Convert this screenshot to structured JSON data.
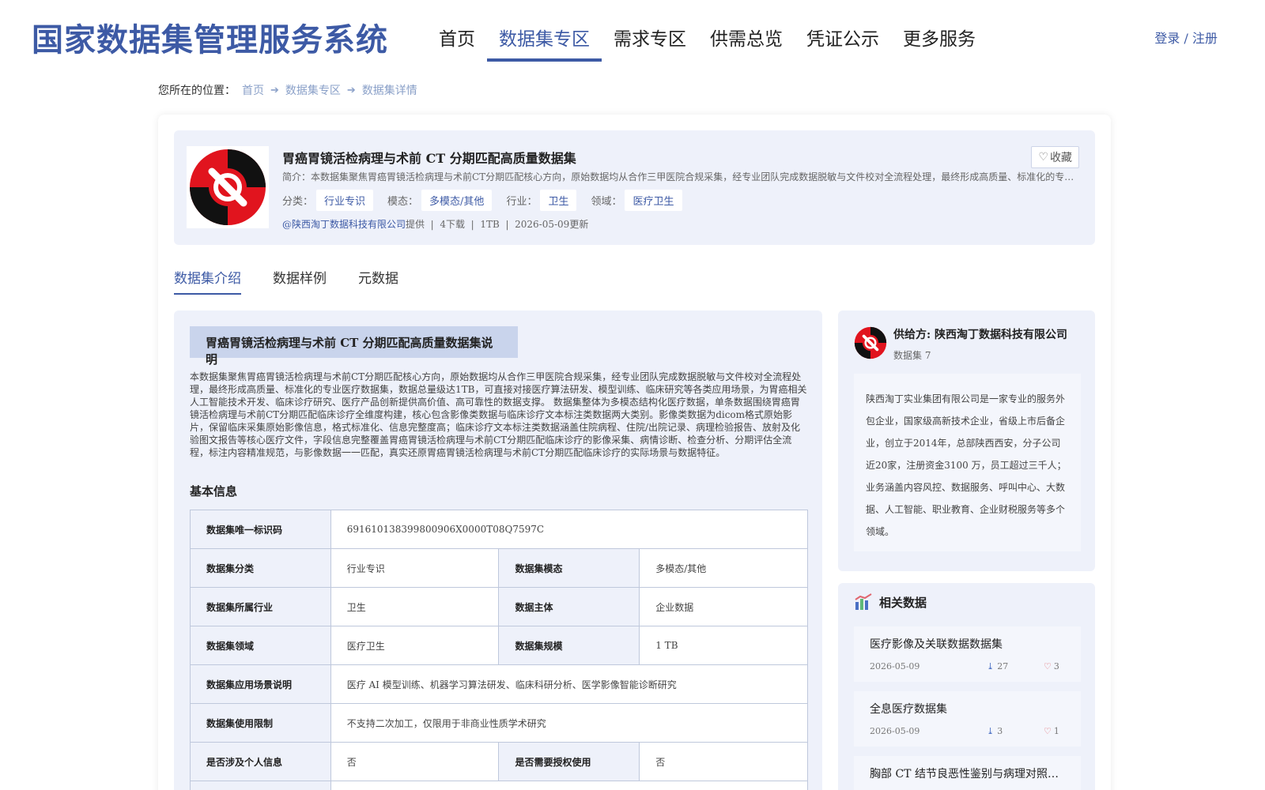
{
  "header": {
    "site_title": "国家数据集管理服务系统",
    "nav": [
      "首页",
      "数据集专区",
      "需求专区",
      "供需总览",
      "凭证公示",
      "更多服务"
    ],
    "active_nav": "数据集专区",
    "login": "登录 / 注册"
  },
  "breadcrumb": {
    "prefix": "您所在的位置：",
    "items": [
      "首页",
      "数据集专区",
      "数据集详情"
    ]
  },
  "dataset": {
    "title": "胃癌胃镜活检病理与术前 CT 分期匹配高质量数据集",
    "intro": "简介：本数据集聚焦胃癌胃镜活检病理与术前CT分期匹配核心方向，原始数据均从合作三甲医院合规采集，经专业团队完成数据脱敏与文件校对全流程处理，最终形成高质量、标准化的专业医疗数据集",
    "favorite_label": "收藏",
    "tags": [
      {
        "label": "分类：",
        "value": "行业专识"
      },
      {
        "label": "模态：",
        "value": "多模态/其他"
      },
      {
        "label": "行业：",
        "value": "卫生"
      },
      {
        "label": "领域：",
        "value": "医疗卫生"
      }
    ],
    "provider": "@陕西淘丁数据科技有限公司",
    "provided_suffix": "提供",
    "downloads": "4下载",
    "size": "1TB",
    "updated": "2026-05-09更新"
  },
  "tabs": [
    "数据集介绍",
    "数据样例",
    "元数据"
  ],
  "active_tab": "数据集介绍",
  "description": {
    "heading": "胃癌胃镜活检病理与术前 CT 分期匹配高质量数据集说明",
    "body": "本数据集聚焦胃癌胃镜活检病理与术前CT分期匹配核心方向，原始数据均从合作三甲医院合规采集，经专业团队完成数据脱敏与文件校对全流程处理，最终形成高质量、标准化的专业医疗数据集，数据总量级达1TB，可直接对接医疗算法研发、模型训练、临床研究等各类应用场景，为胃癌相关人工智能技术开发、临床诊疗研究、医疗产品创新提供高价值、高可靠性的数据支撑。 数据集整体为多模态结构化医疗数据，单条数据围绕胃癌胃镜活检病理与术前CT分期匹配临床诊疗全维度构建，核心包含影像类数据与临床诊疗文本标注类数据两大类别。影像类数据为dicom格式原始影片，保留临床采集原始影像信息，格式标准化、信息完整度高；临床诊疗文本标注类数据涵盖住院病程、住院/出院记录、病理检验报告、放射及化验图文报告等核心医疗文件，字段信息完整覆盖胃癌胃镜活检病理与术前CT分期匹配临床诊疗的影像采集、病情诊断、检查分析、分期评估全流程，标注内容精准规范，与影像数据一一匹配，真实还原胃癌胃镜活检病理与术前CT分期匹配临床诊疗的实际场景与数据特征。"
  },
  "basic_info": {
    "title": "基本信息",
    "rows": [
      {
        "k1": "数据集唯一标识码",
        "v1": "691610138399800906X0000T08Q7597C"
      },
      {
        "k1": "数据集分类",
        "v1": "行业专识",
        "k2": "数据集模态",
        "v2": "多模态/其他"
      },
      {
        "k1": "数据集所属行业",
        "v1": "卫生",
        "k2": "数据主体",
        "v2": "企业数据"
      },
      {
        "k1": "数据集领域",
        "v1": "医疗卫生",
        "k2": "数据集规模",
        "v2": "1 TB"
      },
      {
        "k1": "数据集应用场景说明",
        "v1": "医疗 AI 模型训练、机器学习算法研发、临床科研分析、医学影像智能诊断研究"
      },
      {
        "k1": "数据集使用限制",
        "v1": "不支持二次加工，仅限用于非商业性质学术研究"
      },
      {
        "k1": "是否涉及个人信息",
        "v1": "否",
        "k2": "是否需要授权使用",
        "v2": "否"
      }
    ]
  },
  "supplier": {
    "name": "供给方: 陕西淘丁数据科技有限公司",
    "count": "数据集 7",
    "intro": "陕西淘丁实业集团有限公司是一家专业的服务外包企业，国家级高新技术企业，省级上市后备企业，创立于2014年，总部陕西西安，分子公司近20家，注册资金3100 万，员工超过三千人；业务涵盖内容风控、数据服务、呼叫中心、大数据、人工智能、职业教育、企业财税服务等多个领域。"
  },
  "related": {
    "title": "相关数据",
    "items": [
      {
        "name": "医疗影像及关联数据数据集",
        "date": "2026-05-09",
        "downloads": "27",
        "likes": "3"
      },
      {
        "name": "全息医疗数据集",
        "date": "2026-05-09",
        "downloads": "3",
        "likes": "1"
      },
      {
        "name": "胸部 CT 结节良恶性鉴别与病理对照数据集",
        "date": "",
        "downloads": "",
        "likes": ""
      }
    ]
  },
  "colors": {
    "accent": "#3d5aa5",
    "panel": "#eef1fa",
    "like": "#e0666e"
  }
}
